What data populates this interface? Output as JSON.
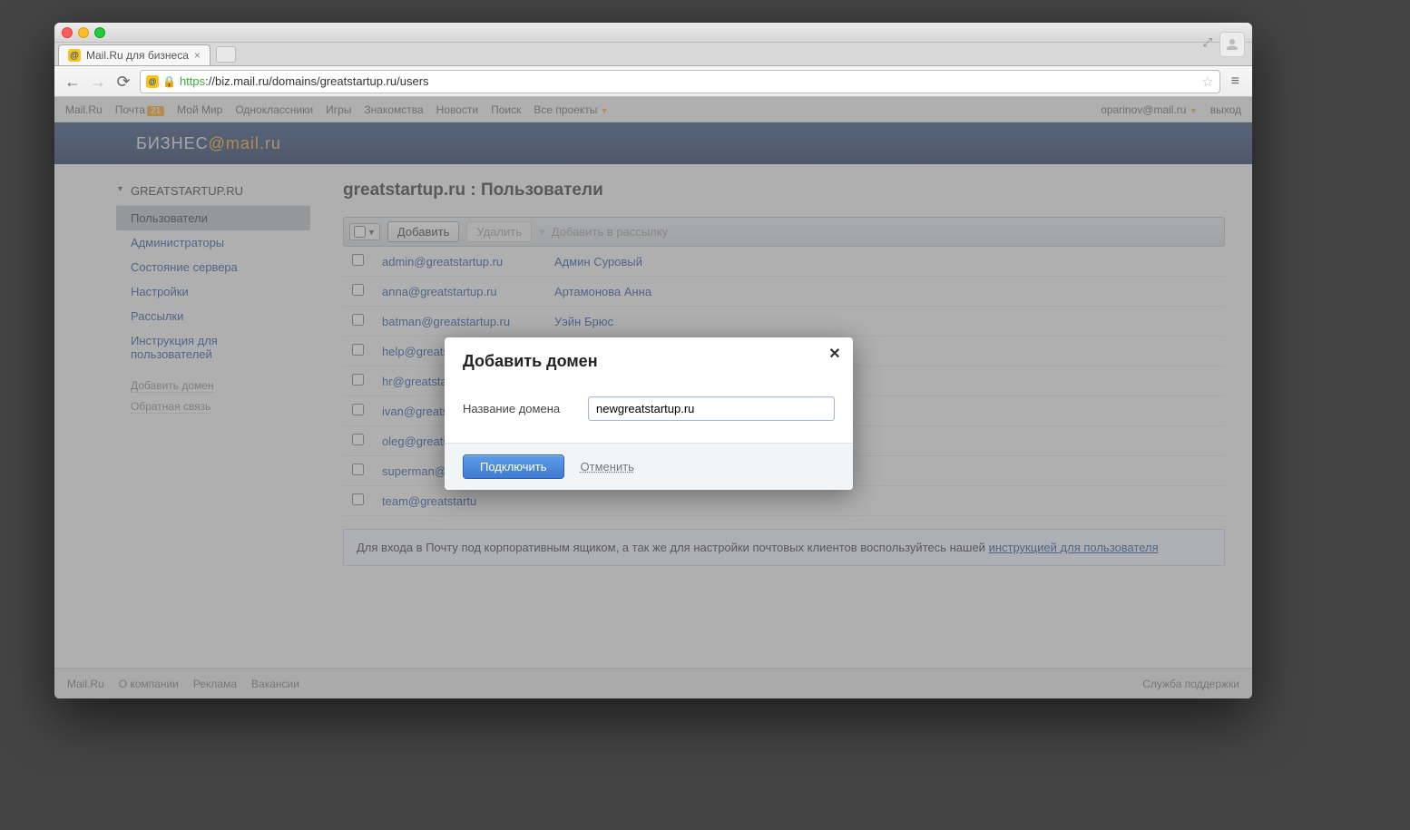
{
  "browser": {
    "tab_title": "Mail.Ru для бизнеса",
    "url_display_https": "https",
    "url_display_rest": "://biz.mail.ru/domains/greatstartup.ru/users"
  },
  "mailru_bar": {
    "links": [
      "Mail.Ru",
      "Почта",
      "Мой Мир",
      "Одноклассники",
      "Игры",
      "Знакомства",
      "Новости",
      "Поиск",
      "Все проекты"
    ],
    "mail_badge": "21",
    "user_email": "oparinov@mail.ru",
    "logout": "выход"
  },
  "logo": {
    "biz": "БИЗНЕС",
    "at": "@",
    "mail": "mail",
    "ru": ".ru"
  },
  "sidebar": {
    "domain": "GREATSTARTUP.RU",
    "items": [
      "Пользователи",
      "Администраторы",
      "Состояние сервера",
      "Настройки",
      "Рассылки",
      "Инструкция для пользователей"
    ],
    "links": [
      "Добавить домен",
      "Обратная связь"
    ]
  },
  "main": {
    "title": "greatstartup.ru : Пользователи",
    "toolbar": {
      "add": "Добавить",
      "delete": "Удалить",
      "add_to_list": "Добавить в рассылку"
    },
    "users": [
      {
        "email": "admin@greatstartup.ru",
        "name": "Админ Суровый"
      },
      {
        "email": "anna@greatstartup.ru",
        "name": "Артамонова Анна"
      },
      {
        "email": "batman@greatstartup.ru",
        "name": "Уэйн Брюс"
      },
      {
        "email": "help@greatstartup.ru",
        "name": ""
      },
      {
        "email": "hr@greatstartup.",
        "name": ""
      },
      {
        "email": "ivan@greatstartu",
        "name": ""
      },
      {
        "email": "oleg@greatstartu",
        "name": ""
      },
      {
        "email": "superman@grea",
        "name": ""
      },
      {
        "email": "team@greatstartu",
        "name": ""
      }
    ],
    "info_text": "Для входа в Почту под корпоративным ящиком, а так же для настройки почтовых клиентов воспользуйтесь нашей ",
    "info_link": "инструкцией для пользователя"
  },
  "footer": {
    "links": [
      "Mail.Ru",
      "О компании",
      "Реклама",
      "Вакансии"
    ],
    "support": "Служба поддержки"
  },
  "modal": {
    "title": "Добавить домен",
    "label": "Название домена",
    "value": "newgreatstartup.ru",
    "submit": "Подключить",
    "cancel": "Отменить"
  }
}
